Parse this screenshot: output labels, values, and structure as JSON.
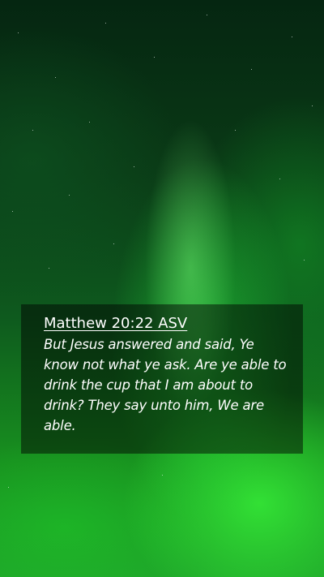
{
  "verse": {
    "reference": "Matthew 20:22 ASV",
    "text": "But Jesus answered and said, Ye know not what ye ask. Are ye able to drink the cup that I am about to drink? They say unto him, We are able."
  },
  "background": {
    "description_colors": [
      "#041a08",
      "#0e5a1e",
      "#1fa52a"
    ],
    "accent": "#3cff3c"
  }
}
